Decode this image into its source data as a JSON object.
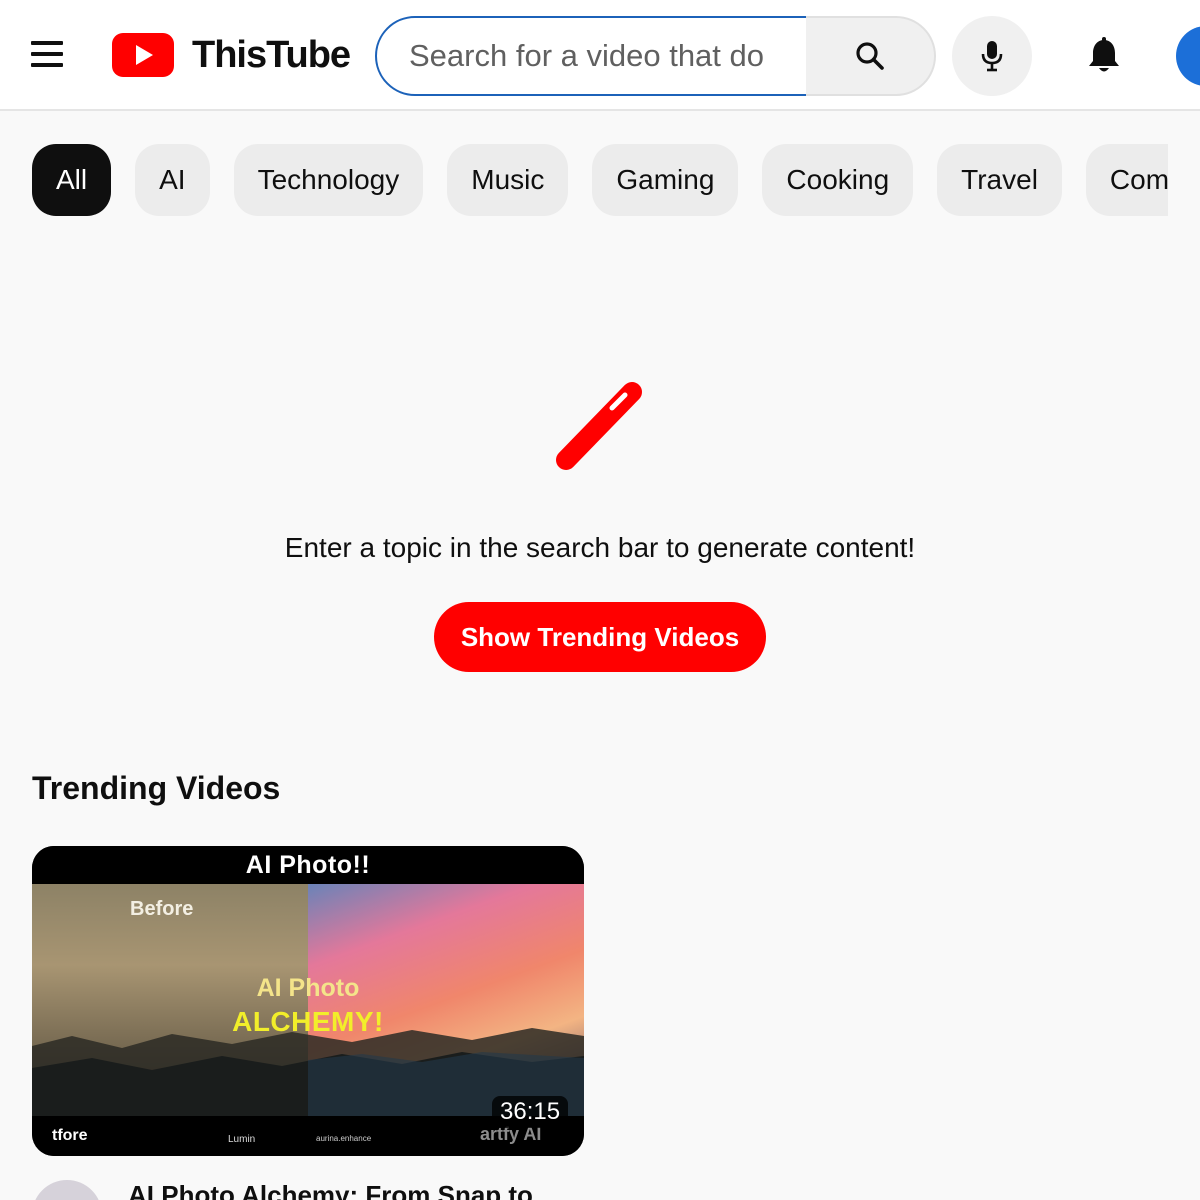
{
  "app": {
    "title": "ThisTube",
    "brand_color": "#ff0000",
    "accent_color": "#1c62b9"
  },
  "header": {
    "search": {
      "placeholder": "Search for a video that do",
      "value": ""
    },
    "icons": [
      "menu-icon",
      "logo-play-icon",
      "search-icon",
      "microphone-icon",
      "bell-icon"
    ]
  },
  "chips": [
    {
      "label": "All",
      "active": true
    },
    {
      "label": "AI"
    },
    {
      "label": "Technology"
    },
    {
      "label": "Music"
    },
    {
      "label": "Gaming"
    },
    {
      "label": "Cooking"
    },
    {
      "label": "Travel"
    },
    {
      "label": "Com"
    }
  ],
  "empty_state": {
    "icon": "magic-wand-icon",
    "message": "Enter a topic in the search bar to generate content!",
    "button_label": "Show Trending Videos"
  },
  "trending": {
    "heading": "Trending Videos",
    "videos": [
      {
        "title": "AI Photo Alchemy: From Snap to",
        "duration": "36:15",
        "thumbnail": {
          "header": "AI Photo!!",
          "before_label": "Before",
          "overlay_line1": "AI Photo",
          "overlay_line2": "ALCHEMY!",
          "watermarks": [
            "tfore",
            "Lumin",
            "aurina.enhance",
            "artfy AI"
          ]
        }
      }
    ]
  }
}
